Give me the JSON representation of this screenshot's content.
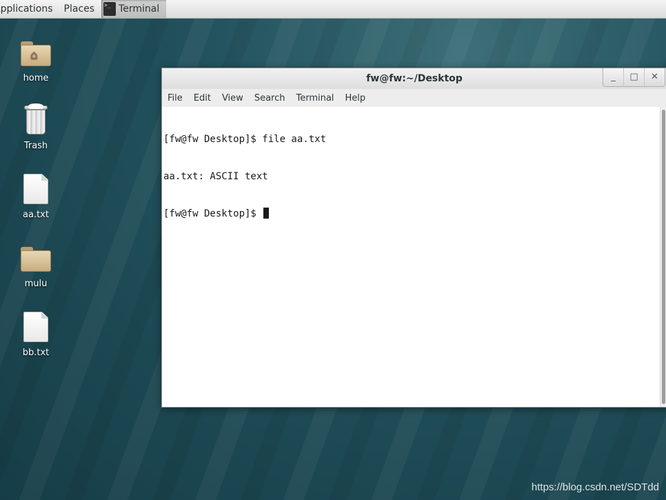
{
  "top_panel": {
    "applications_label": "Applications",
    "places_label": "Places",
    "task_label": "Terminal"
  },
  "desktop_icons": [
    {
      "label": "home",
      "icon": "home-folder-icon"
    },
    {
      "label": "Trash",
      "icon": "trash-icon"
    },
    {
      "label": "aa.txt",
      "icon": "text-file-icon"
    },
    {
      "label": "mulu",
      "icon": "folder-icon"
    },
    {
      "label": "bb.txt",
      "icon": "text-file-icon"
    }
  ],
  "terminal": {
    "title": "fw@fw:~/Desktop",
    "controls": {
      "minimize": "_",
      "maximize": "□",
      "close": "✕"
    },
    "menu": [
      "File",
      "Edit",
      "View",
      "Search",
      "Terminal",
      "Help"
    ],
    "lines": [
      "[fw@fw Desktop]$ file aa.txt",
      "aa.txt: ASCII text",
      "[fw@fw Desktop]$ "
    ]
  },
  "watermark": "https://blog.csdn.net/SDTdd",
  "colors": {
    "desktop_bg": "#1d4a56",
    "terminal_bg": "#ffffff",
    "terminal_fg": "#1a1a1a"
  }
}
